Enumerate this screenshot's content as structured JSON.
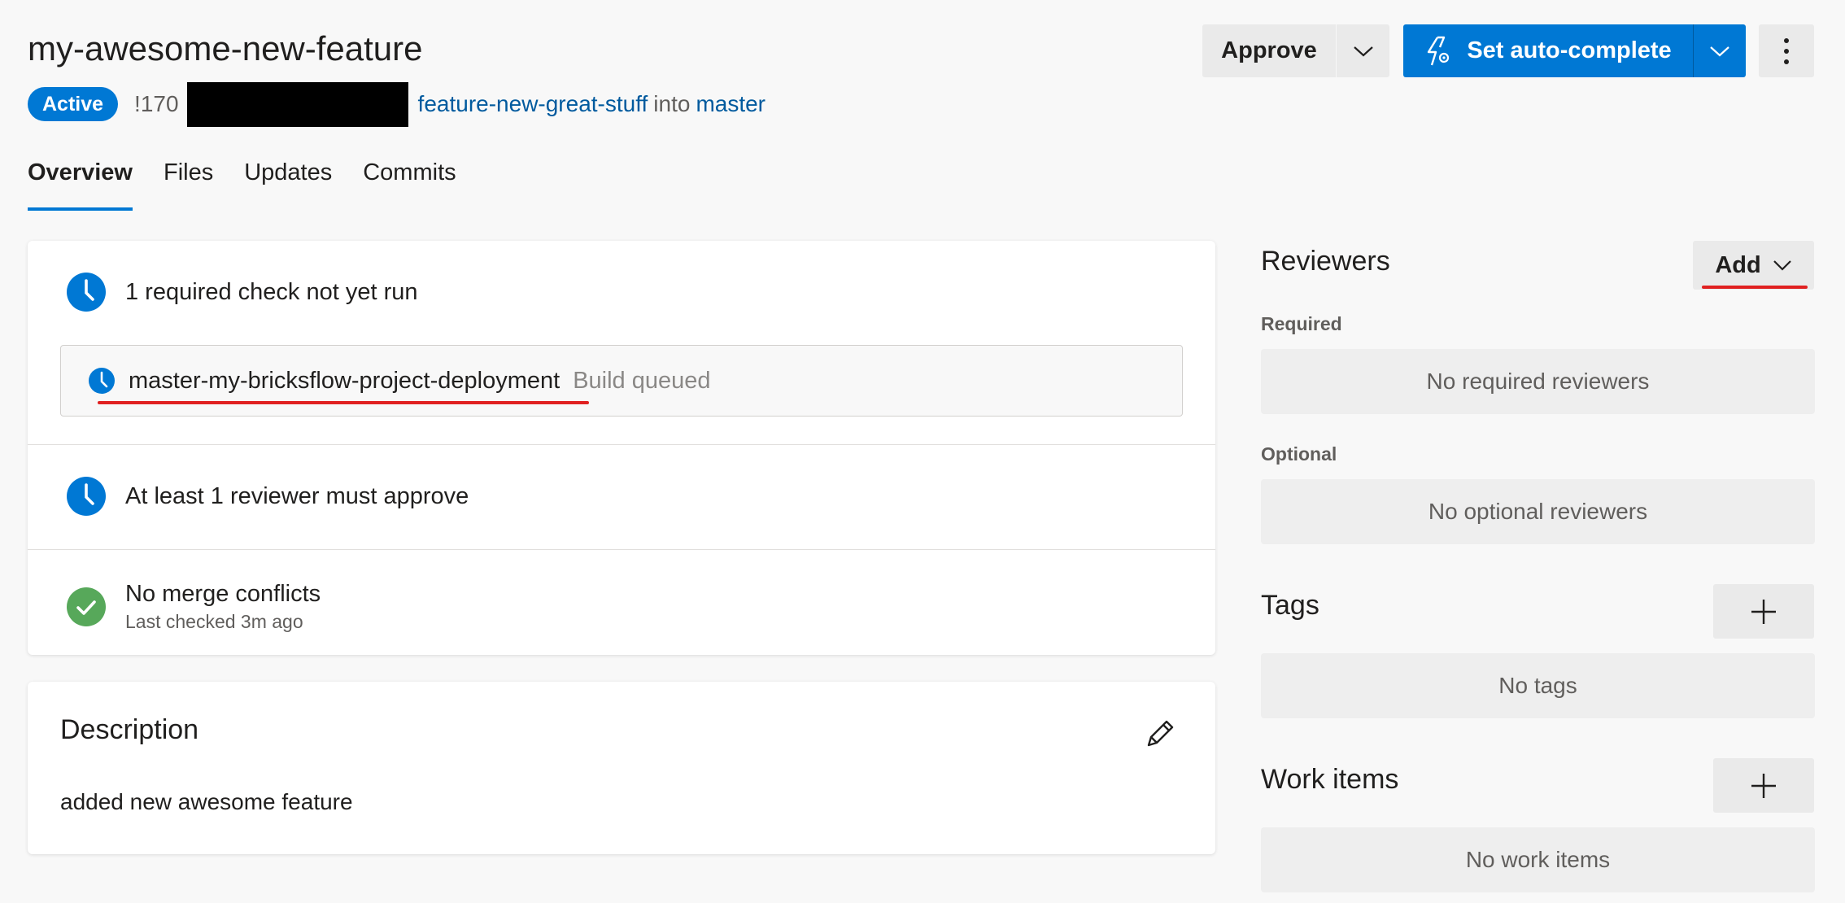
{
  "header": {
    "title": "my-awesome-new-feature",
    "status_badge": "Active",
    "pr_id": "!170",
    "source_branch": "feature-new-great-stuff",
    "into_text": "into",
    "target_branch": "master"
  },
  "actions": {
    "approve_label": "Approve",
    "autocomplete_label": "Set auto-complete"
  },
  "tabs": [
    {
      "label": "Overview",
      "active": true
    },
    {
      "label": "Files"
    },
    {
      "label": "Updates"
    },
    {
      "label": "Commits"
    }
  ],
  "checks": {
    "required_check": "1 required check not yet run",
    "build": {
      "name": "master-my-bricksflow-project-deployment",
      "status": "Build queued"
    },
    "reviewer_policy": "At least 1 reviewer must approve",
    "merge": {
      "title": "No merge conflicts",
      "subtitle": "Last checked 3m ago"
    }
  },
  "description": {
    "title": "Description",
    "text": "added new awesome feature"
  },
  "sidebar": {
    "reviewers_title": "Reviewers",
    "add_label": "Add",
    "required_label": "Required",
    "required_empty": "No required reviewers",
    "optional_label": "Optional",
    "optional_empty": "No optional reviewers",
    "tags_title": "Tags",
    "tags_empty": "No tags",
    "work_items_title": "Work items",
    "work_items_empty": "No work items"
  },
  "colors": {
    "accent": "#0078d4",
    "success": "#57a85a",
    "annotation": "#e02020"
  }
}
